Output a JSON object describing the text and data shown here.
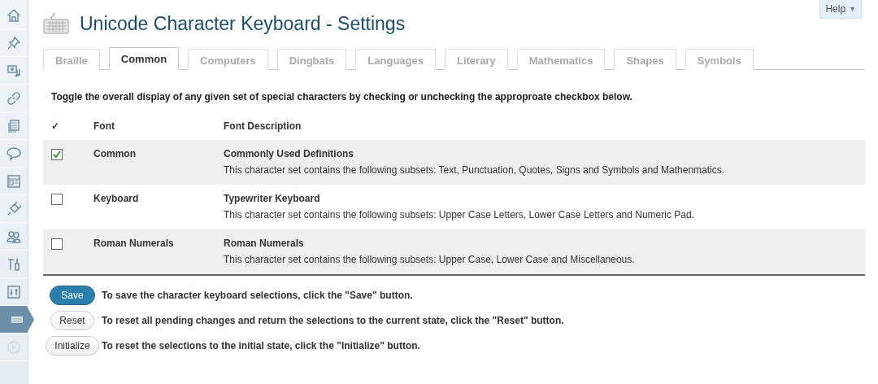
{
  "sidebar": {
    "items": [
      {
        "selected": false
      },
      {
        "selected": false
      },
      {
        "selected": false
      },
      {
        "selected": false
      },
      {
        "selected": false
      },
      {
        "selected": false
      },
      {
        "selected": false
      },
      {
        "selected": false
      },
      {
        "selected": false
      },
      {
        "selected": false
      },
      {
        "selected": false
      },
      {
        "selected": true
      },
      {
        "selected": false
      }
    ]
  },
  "help_button": {
    "label": "Help",
    "caret": "▼"
  },
  "title": "Unicode Character Keyboard - Settings",
  "tabs": [
    {
      "label": "Braille",
      "selected": false
    },
    {
      "label": "Common",
      "selected": true
    },
    {
      "label": "Computers",
      "selected": false
    },
    {
      "label": "Dingbats",
      "selected": false
    },
    {
      "label": "Languages",
      "selected": false
    },
    {
      "label": "Literary",
      "selected": false
    },
    {
      "label": "Mathematics",
      "selected": false
    },
    {
      "label": "Shapes",
      "selected": false
    },
    {
      "label": "Symbols",
      "selected": false
    }
  ],
  "instructions": "Toggle the overall display of any given set of special characters by checking or unchecking the approproate checkbox below.",
  "table": {
    "columns": [
      "✓",
      "Font",
      "Font Description"
    ],
    "rows": [
      {
        "checked": true,
        "font": "Common",
        "title": "Commonly Used Definitions",
        "description": "This character set contains the following subsets: Text, Punctuation, Quotes, Signs and Symbols and Mathenmatics."
      },
      {
        "checked": false,
        "font": "Keyboard",
        "title": "Typewriter Keyboard",
        "description": "This character set contains the following subsets: Upper Case Letters, Lower Case Letters and Numeric Pad."
      },
      {
        "checked": false,
        "font": "Roman Numerals",
        "title": "Roman Numerals",
        "description": "This character set contains the following subsets: Upper Case, Lower Case and Miscellaneous."
      }
    ]
  },
  "actions": [
    {
      "kind": "primary",
      "label": "Save",
      "hint": "To save the character keyboard selections, click the \"Save\" button."
    },
    {
      "kind": "secondary",
      "label": "Reset",
      "hint": "To reset all pending changes and return the selections to the current state, click the \"Reset\" button."
    },
    {
      "kind": "secondary",
      "label": "Initialize",
      "hint": "To reset the selections to the initial state, click the \"Initialize\" button."
    }
  ]
}
